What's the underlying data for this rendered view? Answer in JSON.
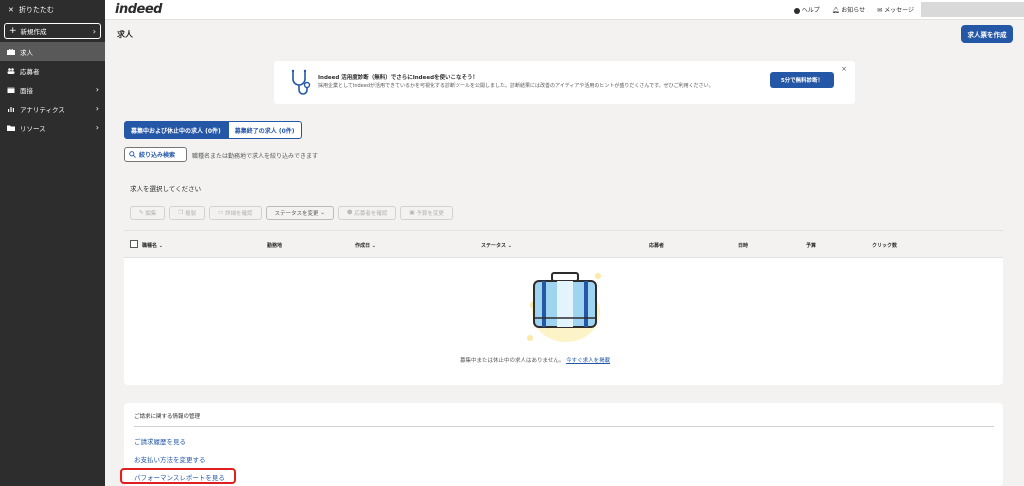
{
  "sidebar": {
    "collapse_label": "折りたたむ",
    "new_label": "新規作成",
    "items": [
      {
        "label": "求人",
        "icon": "briefcase-icon"
      },
      {
        "label": "応募者",
        "icon": "people-icon"
      },
      {
        "label": "面接",
        "icon": "calendar-icon"
      },
      {
        "label": "アナリティクス",
        "icon": "chart-icon"
      },
      {
        "label": "リソース",
        "icon": "folder-icon"
      }
    ]
  },
  "header": {
    "logo": "indeed",
    "help": "ヘルプ",
    "notifications": "お知らせ",
    "messages": "メッセージ"
  },
  "page": {
    "title": "求人",
    "create_button": "求人票を作成"
  },
  "banner": {
    "title": "Indeed 活用度診断（無料）でさらにIndeedを使いこなそう！",
    "body": "採用企業としてIndeedが活用できているかを可視化する診断ツールを公開しました。診断結果には改善のアイディアや活用のヒントが盛りだくさんです。ぜひご利用ください。",
    "button": "5分で無料診断！",
    "close": "×"
  },
  "tabs": {
    "active": "募集中および休止中の求人 (0件)",
    "inactive": "募集終了の求人 (0件)"
  },
  "filter": {
    "button": "絞り込み検索",
    "hint": "職種名または勤務地で求人を絞り込みできます"
  },
  "jobs": {
    "select_prompt": "求人を選択してください",
    "toolbar": [
      "編集",
      "複製",
      "詳細を確認",
      "ステータスを変更",
      "応募者を確認",
      "予算を変更"
    ],
    "columns": [
      "職種名",
      "勤務地",
      "作成日",
      "ステータス",
      "応募者",
      "日時",
      "予算",
      "クリック数"
    ],
    "empty_message": "募集中または休止中の求人はありません。",
    "empty_link": "今すぐ求人を掲載"
  },
  "billing": {
    "title": "ご請求に関する情報の管理",
    "links": [
      "ご請求履歴を見る",
      "お支払い方法を変更する",
      "パフォーマンスレポートを見る"
    ]
  },
  "colors": {
    "primary": "#2557a7",
    "sidebar_bg": "#2d2d2d",
    "highlight": "#e02020"
  }
}
